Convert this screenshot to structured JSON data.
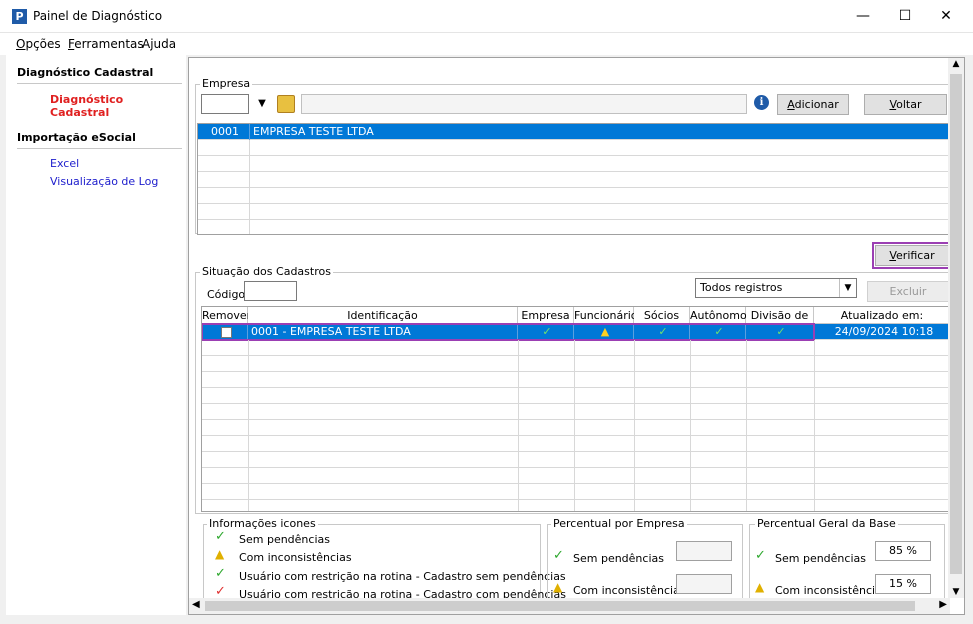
{
  "window": {
    "title": "Painel de Diagnóstico",
    "minimize": "—",
    "maximize": "☐",
    "close": "✕"
  },
  "menu": [
    {
      "first": "O",
      "rest": "pções"
    },
    {
      "first": "F",
      "rest": "erramentas"
    },
    {
      "first": "",
      "rest": "Ajuda"
    }
  ],
  "sidebar": {
    "section1": "Diagnóstico Cadastral",
    "section1_link": "Diagnóstico Cadastral",
    "section2": "Importação eSocial",
    "section2_links": [
      "Excel",
      "Visualização de Log"
    ]
  },
  "empresa": {
    "group_title": "Empresa",
    "add_button": "Adicionar",
    "back_button": "Voltar",
    "rows": [
      {
        "code": "0001",
        "name": "EMPRESA TESTE LTDA"
      }
    ]
  },
  "verify_button": "Verificar",
  "situacao": {
    "group_title": "Situação dos Cadastros",
    "code_label": "Código:",
    "filter": "Todos registros",
    "delete_button": "Excluir",
    "columns": [
      "Remover",
      "Identificação",
      "Empresa",
      "Funcionários",
      "Sócios",
      "Autônomos",
      "Divisão de RH",
      "Atualizado em:"
    ],
    "rows": [
      {
        "id": "0001 - EMPRESA TESTE LTDA",
        "updated": "24/09/2024 10:18"
      }
    ]
  },
  "info": {
    "title": "Informações icones",
    "items": [
      "Sem pendências",
      "Com inconsistências",
      "Usuário com restrição na rotina - Cadastro sem pendências",
      "Usuário com restrição na rotina - Cadastro com pendências"
    ]
  },
  "percent_empresa": {
    "title": "Percentual por Empresa",
    "ok_label": "Sem pendências",
    "warn_label": "Com inconsistências"
  },
  "percent_base": {
    "title": "Percentual Geral da Base",
    "ok_label": "Sem pendências",
    "warn_label": "Com inconsistências",
    "ok_value": "85 %",
    "warn_value": "15 %"
  }
}
